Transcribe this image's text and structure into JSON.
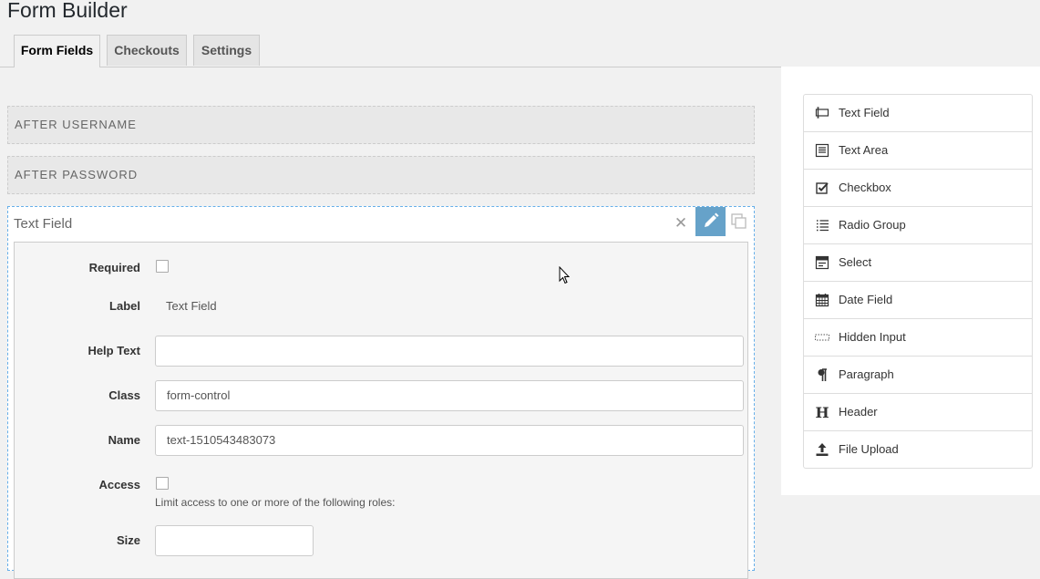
{
  "page": {
    "title": "Form Builder"
  },
  "tabs": [
    {
      "label": "Form Fields",
      "active": true
    },
    {
      "label": "Checkouts",
      "active": false
    },
    {
      "label": "Settings",
      "active": false
    }
  ],
  "stage": {
    "zones": [
      "AFTER USERNAME",
      "AFTER PASSWORD"
    ],
    "field": {
      "title": "Text Field",
      "required_label": "Required",
      "label_label": "Label",
      "label_value": "Text Field",
      "help_label": "Help Text",
      "help_value": "",
      "class_label": "Class",
      "class_value": "form-control",
      "name_label": "Name",
      "name_value": "text-1510543483073",
      "access_label": "Access",
      "access_note": "Limit access to one or more of the following roles:",
      "size_label": "Size",
      "size_value": ""
    }
  },
  "controls": [
    {
      "label": "Text Field",
      "icon": "text-field-icon"
    },
    {
      "label": "Text Area",
      "icon": "text-area-icon"
    },
    {
      "label": "Checkbox",
      "icon": "checkbox-icon"
    },
    {
      "label": "Radio Group",
      "icon": "radio-group-icon"
    },
    {
      "label": "Select",
      "icon": "select-icon"
    },
    {
      "label": "Date Field",
      "icon": "date-field-icon"
    },
    {
      "label": "Hidden Input",
      "icon": "hidden-input-icon"
    },
    {
      "label": "Paragraph",
      "icon": "paragraph-icon"
    },
    {
      "label": "Header",
      "icon": "header-icon"
    },
    {
      "label": "File Upload",
      "icon": "file-upload-icon"
    }
  ],
  "colors": {
    "accent": "#66a2c9",
    "background": "#f1f1f1",
    "card_border": "#66afe9"
  }
}
